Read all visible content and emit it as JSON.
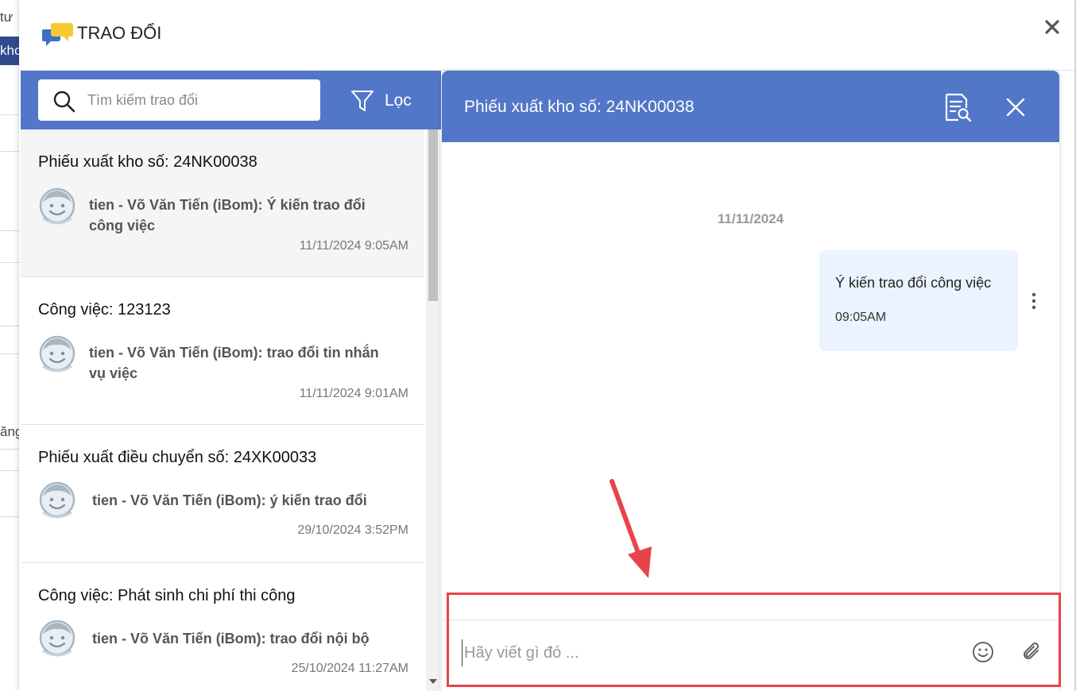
{
  "background": {
    "fragments": [
      "tư",
      "kho",
      "ăng"
    ]
  },
  "modal": {
    "title": "TRAO ĐỔI",
    "close_icon": "close-icon",
    "logo_icon": "chat-bubbles-icon"
  },
  "left_panel": {
    "search": {
      "placeholder": "Tìm kiếm trao đổi",
      "icon": "search-icon"
    },
    "filter": {
      "label": "Lọc",
      "icon": "filter-icon"
    },
    "conversations": [
      {
        "title": "Phiếu xuất kho số: 24NK00038",
        "preview": "tien - Võ Văn Tiến (iBom): Ý kiến trao đổi công việc",
        "time": "11/11/2024 9:05AM",
        "active": true
      },
      {
        "title": "Công việc: 123123",
        "preview": "tien - Võ Văn Tiến (iBom): trao đổi tin nhắn vụ việc",
        "time": "11/11/2024 9:01AM",
        "active": false
      },
      {
        "title": "Phiếu xuất điều chuyển số: 24XK00033",
        "preview": "tien - Võ Văn Tiến (iBom): ý kiến trao đổi",
        "time": "29/10/2024 3:52PM",
        "active": false
      },
      {
        "title": "Công việc: Phát sinh chi phí thi công",
        "preview": "tien - Võ Văn Tiến (iBom): trao đổi nội bộ",
        "time": "25/10/2024 11:27AM",
        "active": false
      }
    ]
  },
  "chat": {
    "title": "Phiếu xuất kho số: 24NK00038",
    "detail_icon": "document-search-icon",
    "close_icon": "close-icon",
    "date_divider": "11/11/2024",
    "messages": [
      {
        "text": "Ý kiến trao đổi công việc",
        "time": "09:05AM"
      }
    ],
    "compose": {
      "placeholder": "Hãy viết gì đó ...",
      "emoji_icon": "emoji-icon",
      "attach_icon": "paperclip-icon"
    }
  },
  "colors": {
    "header_blue": "#5277c8",
    "bubble_bg": "#eaf3ff",
    "annotation_red": "#e8434b"
  }
}
